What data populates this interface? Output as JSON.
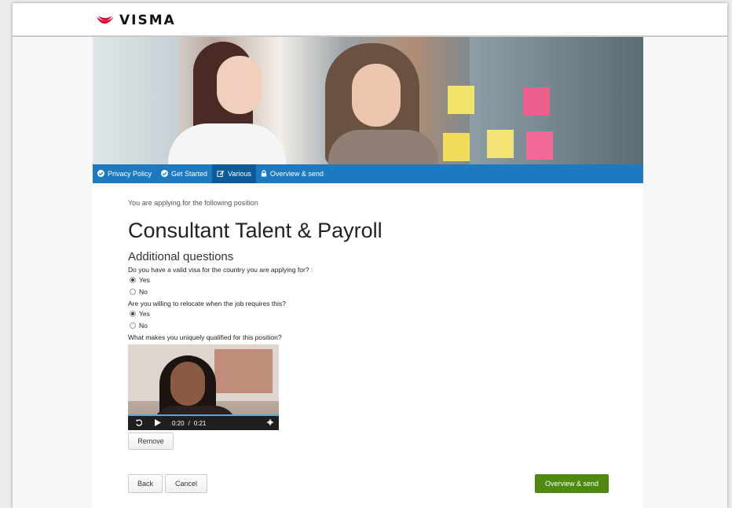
{
  "brand": {
    "name": "VISMA",
    "logo_icon": "visma-swoosh-icon",
    "accent": "#e4002b"
  },
  "nav": {
    "items": [
      {
        "label": "Privacy Policy",
        "icon": "check-circle-icon"
      },
      {
        "label": "Get Started",
        "icon": "check-circle-icon"
      },
      {
        "label": "Various",
        "icon": "edit-icon"
      },
      {
        "label": "Overview & send",
        "icon": "lock-icon"
      }
    ],
    "color": "#1d7ac0",
    "active_color": "#0d5c99"
  },
  "main": {
    "intro": "You are applying for the following position",
    "job_title": "Consultant Talent & Payroll",
    "section_title": "Additional questions",
    "questions": [
      {
        "text": "Do you have a valid visa for the country you are applying for? :",
        "options": [
          "Yes",
          "No"
        ],
        "selected": "Yes"
      },
      {
        "text": "Are you willing to relocate when the job requires this?",
        "options": [
          "Yes",
          "No"
        ],
        "selected": "Yes"
      },
      {
        "text": "What makes you uniquely qualified for this position?"
      }
    ],
    "video": {
      "current_time": "0:20",
      "separator": "/",
      "duration": "0:21"
    },
    "remove_label": "Remove"
  },
  "footer": {
    "back_label": "Back",
    "cancel_label": "Cancel",
    "submit_label": "Overview & send",
    "submit_color": "#4f8a10"
  }
}
